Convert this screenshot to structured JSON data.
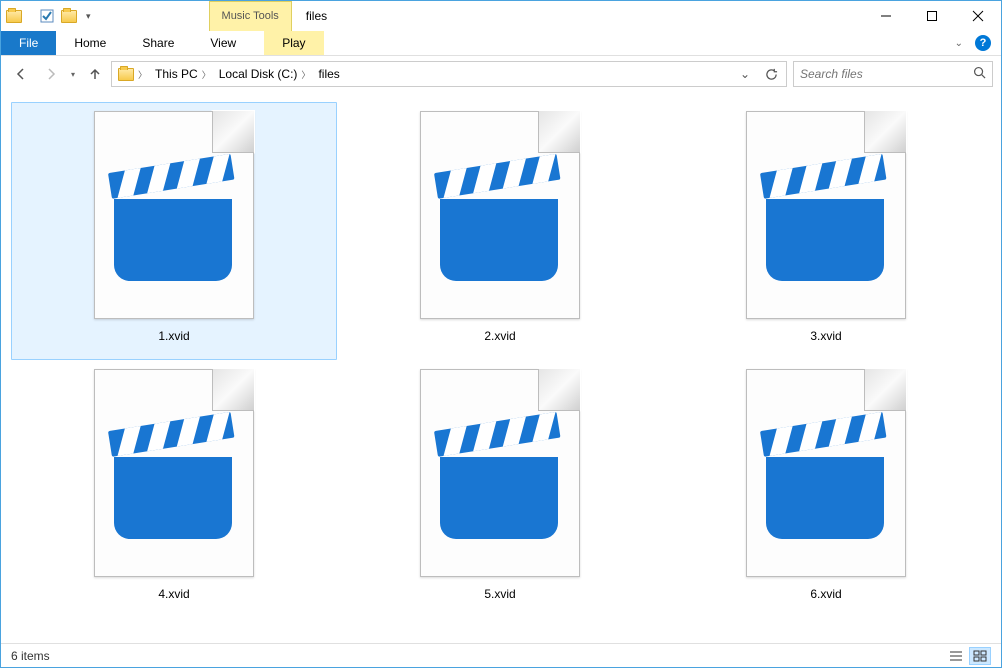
{
  "window": {
    "tools_group": "Music Tools",
    "title": "files"
  },
  "ribbon": {
    "file": "File",
    "tabs": [
      "Home",
      "Share",
      "View"
    ],
    "play": "Play"
  },
  "breadcrumb": {
    "segments": [
      "This PC",
      "Local Disk (C:)",
      "files"
    ]
  },
  "search": {
    "placeholder": "Search files"
  },
  "files": [
    {
      "name": "1.xvid",
      "selected": true
    },
    {
      "name": "2.xvid",
      "selected": false
    },
    {
      "name": "3.xvid",
      "selected": false
    },
    {
      "name": "4.xvid",
      "selected": false
    },
    {
      "name": "5.xvid",
      "selected": false
    },
    {
      "name": "6.xvid",
      "selected": false
    }
  ],
  "status": {
    "count": "6 items"
  }
}
